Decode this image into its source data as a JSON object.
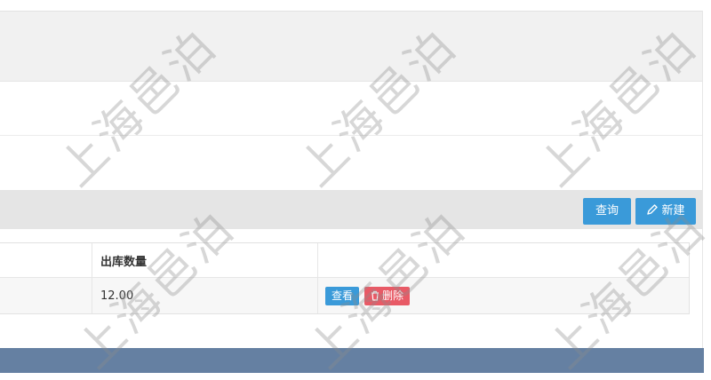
{
  "toolbar": {
    "query_label": "查询",
    "new_label": "新建"
  },
  "table": {
    "columns": [
      "出库数量",
      ""
    ],
    "rows": [
      {
        "quantity": "12.00",
        "actions": [
          "查看",
          "删除"
        ]
      }
    ]
  },
  "watermark": {
    "text": "上海邑泊"
  },
  "icons": [
    "pencil-icon",
    "trash-icon"
  ],
  "colors": {
    "primary": "#3a9ad9",
    "danger": "#e85a66",
    "footer": "#6580a2"
  }
}
